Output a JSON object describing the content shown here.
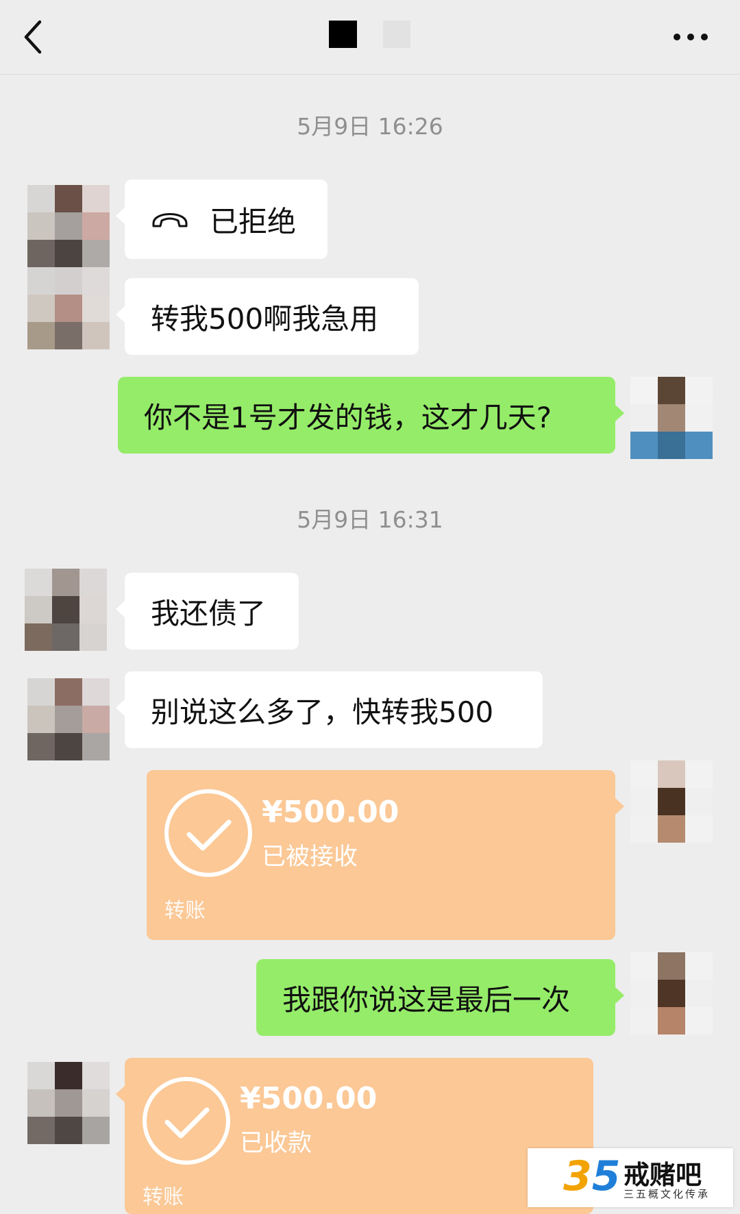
{
  "header": {
    "back_icon": "chevron-left-icon",
    "more_icon": "more-dots-icon"
  },
  "timestamps": [
    "5月9日 16:26",
    "5月9日 16:31"
  ],
  "messages": {
    "m1": {
      "icon": "phone-hangup-icon",
      "text": "已拒绝"
    },
    "m2": {
      "text": "转我500啊我急用"
    },
    "m3": {
      "text": "你不是1号才发的钱，这才几天?"
    },
    "m4": {
      "text": "我还债了"
    },
    "m5": {
      "text": "别说这么多了，快转我500"
    },
    "m6": {
      "amount": "¥500.00",
      "status": "已被接收",
      "label": "转账"
    },
    "m7": {
      "text": "我跟你说这是最后一次"
    },
    "m8": {
      "amount": "¥500.00",
      "status": "已收款",
      "label": "转账"
    }
  },
  "watermark": {
    "digit3": "3",
    "digit5": "5",
    "title": "戒赌吧",
    "subtitle": "三五概文化传承"
  },
  "colors": {
    "background": "#ededed",
    "green_bubble": "#95ec69",
    "white_bubble": "#ffffff",
    "transfer": "#fbc896"
  }
}
